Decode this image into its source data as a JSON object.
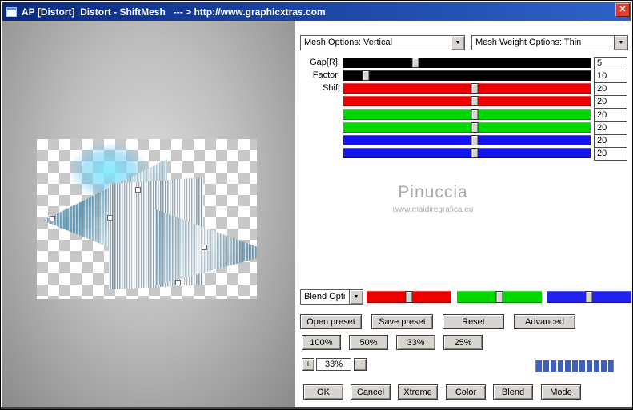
{
  "window": {
    "title": "AP [Distort]  Distort - ShiftMesh   --- > http://www.graphicxtras.com",
    "close": "✕"
  },
  "selects": {
    "mesh_options": "Mesh Options: Vertical",
    "mesh_weight_options": "Mesh Weight Options: Thin",
    "blend_options": "Blend Opti"
  },
  "sliders": [
    {
      "label": "Gap[R]:",
      "value": "5",
      "color": "#000000",
      "thumb": "29%"
    },
    {
      "label": "Factor:",
      "value": "10",
      "color": "#000000",
      "thumb": "9%"
    },
    {
      "label": "Shift",
      "value": "20",
      "color": "#ee0000",
      "thumb": "53%"
    },
    {
      "label": "",
      "value": "20",
      "color": "#ee0000",
      "thumb": "53%"
    },
    {
      "label": "",
      "value": "20",
      "color": "#00d800",
      "thumb": "53%"
    },
    {
      "label": "",
      "value": "20",
      "color": "#00d800",
      "thumb": "53%"
    },
    {
      "label": "",
      "value": "20",
      "color": "#1414ee",
      "thumb": "53%"
    },
    {
      "label": "",
      "value": "20",
      "color": "#1414ee",
      "thumb": "53%"
    }
  ],
  "watermark": {
    "name": "Pinuccia",
    "url": "www.maidiregrafica.eu"
  },
  "blend_sliders": [
    {
      "name": "red",
      "color": "#ee0000",
      "thumb": "50%"
    },
    {
      "name": "green",
      "color": "#00d800",
      "thumb": "50%"
    },
    {
      "name": "blue",
      "color": "#2222ee",
      "thumb": "50%"
    }
  ],
  "preset_buttons": [
    "Open preset",
    "Save preset",
    "Reset",
    "Advanced"
  ],
  "zoom_buttons": [
    "100%",
    "50%",
    "33%",
    "25%"
  ],
  "zoom_control": {
    "plus": "+",
    "value": "33%",
    "minus": "−"
  },
  "bottom_buttons": [
    "OK",
    "Cancel",
    "Xtreme",
    "Color",
    "Blend",
    "Mode"
  ],
  "colors": {
    "titlebar_left": "#0a2a80",
    "titlebar_right": "#2e62c8",
    "close_red": "#e13c2c",
    "progress_blue": "#3d5fc0"
  }
}
